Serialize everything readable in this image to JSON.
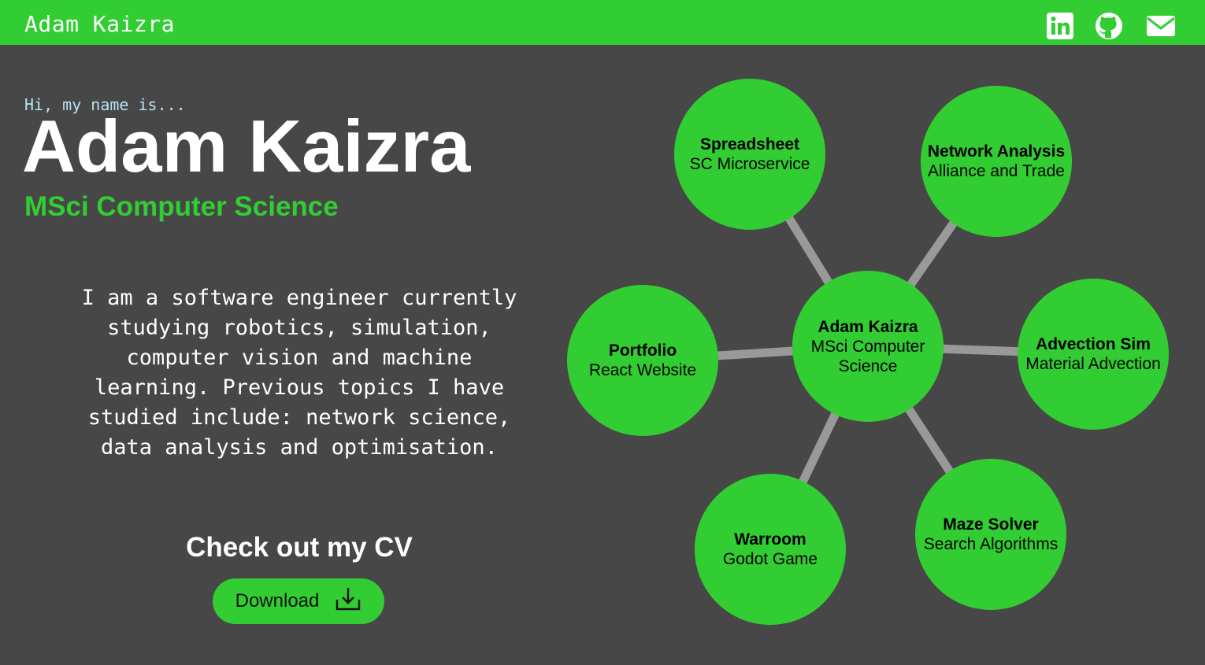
{
  "header": {
    "brand": "Adam Kaizra",
    "social_icons": [
      "linkedin-icon",
      "github-icon",
      "envelope-icon"
    ]
  },
  "hero": {
    "greeting": "Hi, my name is...",
    "name": "Adam Kaizra",
    "degree": "MSci Computer Science",
    "bio": "I am a software engineer currently studying robotics, simulation, computer vision and machine learning. Previous topics I have studied include: network science, data analysis and optimisation."
  },
  "cv": {
    "heading": "Check out my CV",
    "download_label": "Download",
    "download_icon": "download-icon"
  },
  "graph": {
    "center": {
      "title": "Adam Kaizra",
      "subtitle": "MSci Computer Science"
    },
    "projects": [
      {
        "title": "Spreadsheet",
        "subtitle": "SC Microservice"
      },
      {
        "title": "Network Analysis",
        "subtitle": "Alliance and Trade"
      },
      {
        "title": "Portfolio",
        "subtitle": "React Website"
      },
      {
        "title": "Advection Sim",
        "subtitle": "Material Advection"
      },
      {
        "title": "Warroom",
        "subtitle": "Godot Game"
      },
      {
        "title": "Maze Solver",
        "subtitle": "Search Algorithms"
      }
    ]
  },
  "colors": {
    "accent": "#32cd32",
    "background": "#474747",
    "edge": "#999999",
    "greeting": "#b7e2ee"
  }
}
